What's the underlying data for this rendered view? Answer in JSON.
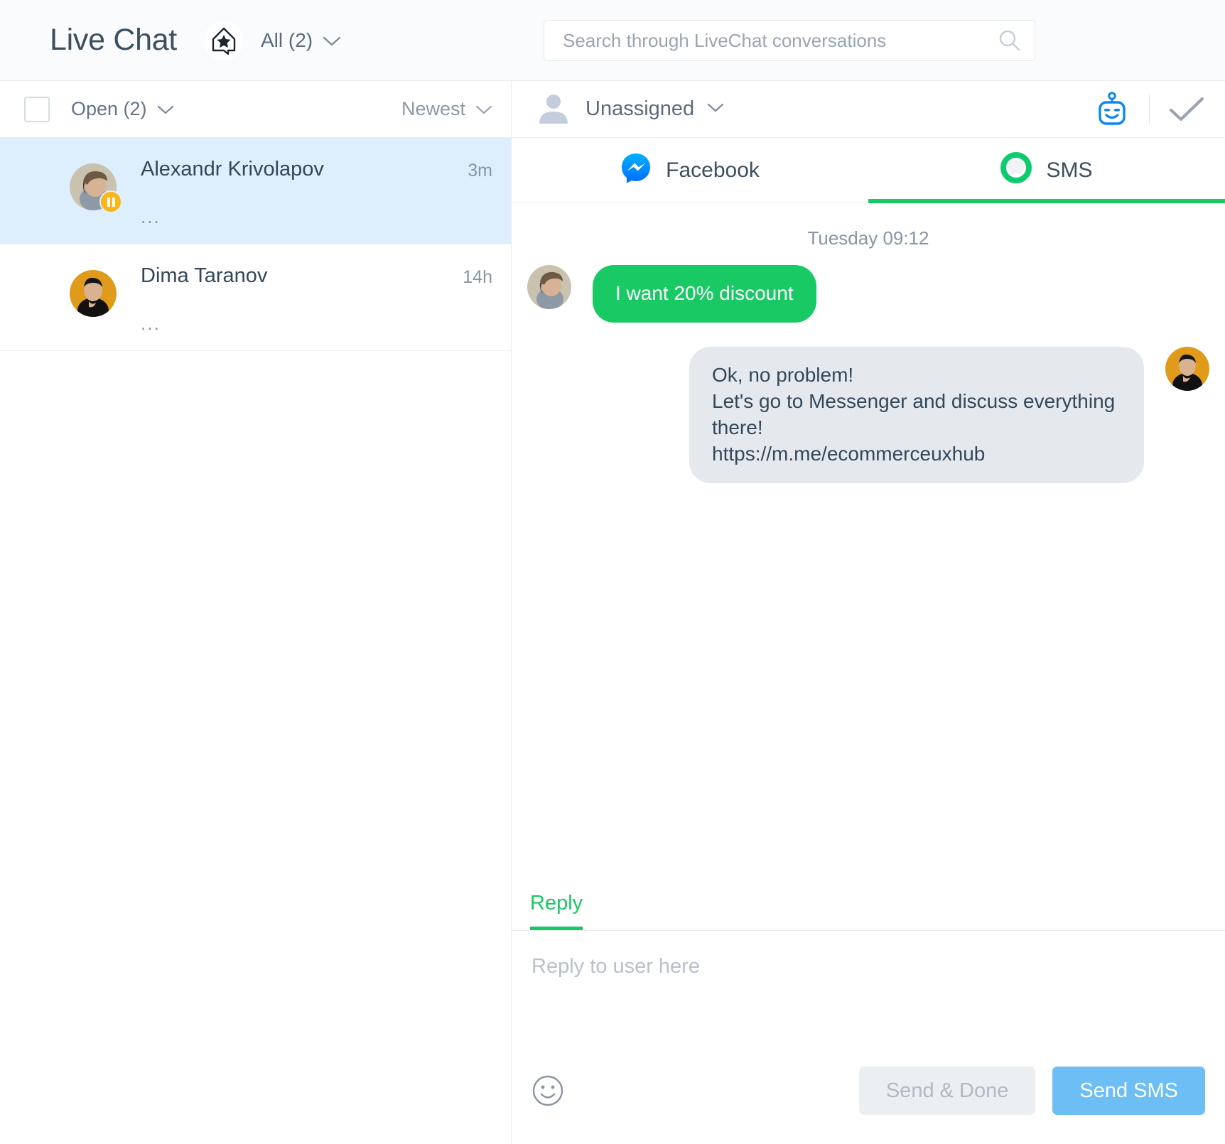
{
  "topbar": {
    "app_title": "Live Chat",
    "brand_icon": "house-star-icon",
    "filter_label": "All (2)",
    "filter_chevron_icon": "chevron-down-icon",
    "search": {
      "placeholder": "Search through LiveChat conversations",
      "value": "",
      "icon": "search-icon"
    }
  },
  "conversation_list": {
    "select_all_checkbox": "unchecked",
    "status_filter_label": "Open (2)",
    "status_chevron_icon": "chevron-down-icon",
    "sort_label": "Newest",
    "sort_chevron_icon": "chevron-down-icon",
    "items": [
      {
        "name": "Alexandr Krivolapov",
        "snippet": "...",
        "time": "3m",
        "selected": true,
        "badge": "pause-icon",
        "avatar_colors": [
          "#c9c2ae",
          "#6d5a45",
          "#8e99a8"
        ]
      },
      {
        "name": "Dima Taranov",
        "snippet": "...",
        "time": "14h",
        "selected": false,
        "badge": "",
        "avatar_colors": [
          "#e09b1b",
          "#1d1d1d",
          "#d9b28f"
        ]
      }
    ]
  },
  "conversation": {
    "assignee_label": "Unassigned",
    "assignee_chevron_icon": "chevron-down-icon",
    "assignee_avatar_icon": "user-avatar-icon",
    "header_actions": [
      {
        "icon": "robot-icon",
        "color": "#0c87f0"
      },
      {
        "icon": "check-icon",
        "color": "#9aa5b1"
      }
    ],
    "channel_tabs": [
      {
        "label": "Facebook",
        "icon": "messenger-icon",
        "active": false
      },
      {
        "label": "SMS",
        "icon": "sms-bubble-icon",
        "active": true
      }
    ],
    "day_stamp": "Tuesday 09:12",
    "messages": [
      {
        "direction": "in",
        "text": "I want 20% discount",
        "bubble_color": "#18c964",
        "text_color": "#ffffff"
      },
      {
        "direction": "out",
        "text": "Ok, no problem!\nLet's go to Messenger and discuss everything there!\nhttps://m.me/ecommerceuxhub",
        "bubble_color": "#e5e9ed",
        "text_color": "#33475b"
      }
    ]
  },
  "composer": {
    "tab_label": "Reply",
    "tab_color": "#17c964",
    "input_placeholder": "Reply to user here",
    "input_value": "",
    "emoji_icon": "smiley-icon",
    "send_done_label": "Send & Done",
    "send_sms_label": "Send SMS",
    "send_sms_color": "#6cbef5"
  }
}
